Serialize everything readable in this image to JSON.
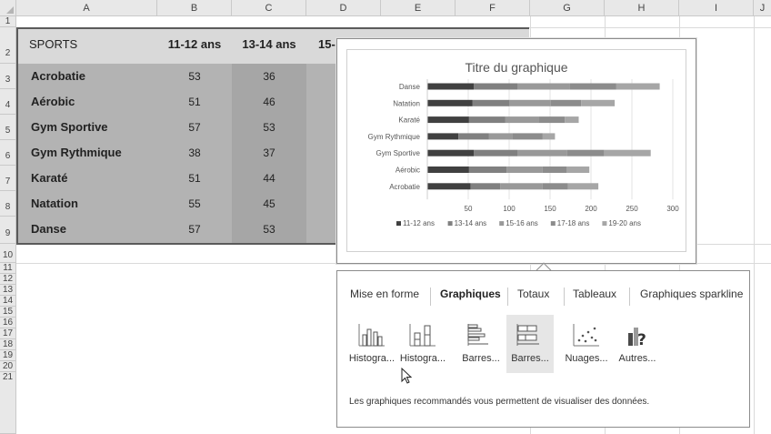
{
  "grid": {
    "columns": [
      "A",
      "B",
      "C",
      "D",
      "E",
      "F",
      "G",
      "H",
      "I",
      "J"
    ],
    "rows": [
      "1",
      "2",
      "3",
      "4",
      "5",
      "6",
      "7",
      "8",
      "9",
      "10",
      "11",
      "12",
      "13",
      "14",
      "15",
      "16",
      "17",
      "18",
      "19",
      "20",
      "21"
    ]
  },
  "table": {
    "header": [
      "SPORTS",
      "11-12 ans",
      "13-14 ans",
      "15-"
    ],
    "rows": [
      {
        "sport": "Acrobatie",
        "b": "53",
        "c": "36"
      },
      {
        "sport": "Aérobic",
        "b": "51",
        "c": "46"
      },
      {
        "sport": "Gym Sportive",
        "b": "57",
        "c": "53"
      },
      {
        "sport": "Gym Rythmique",
        "b": "38",
        "c": "37"
      },
      {
        "sport": "Karaté",
        "b": "51",
        "c": "44"
      },
      {
        "sport": "Natation",
        "b": "55",
        "c": "45"
      },
      {
        "sport": "Danse",
        "b": "57",
        "c": "53"
      }
    ]
  },
  "chart_data": {
    "type": "bar",
    "orientation": "horizontal",
    "stacked": true,
    "title": "Titre du graphique",
    "categories": [
      "Danse",
      "Natation",
      "Karaté",
      "Gym Rythmique",
      "Gym Sportive",
      "Aérobic",
      "Acrobatie"
    ],
    "series": [
      {
        "name": "11-12 ans",
        "values": [
          57,
          55,
          51,
          38,
          57,
          51,
          53
        ],
        "color": "#404040"
      },
      {
        "name": "13-14 ans",
        "values": [
          53,
          45,
          44,
          37,
          53,
          46,
          36
        ],
        "color": "#808080"
      },
      {
        "name": "15-16 ans",
        "values": [
          64,
          51,
          41,
          29,
          61,
          44,
          52
        ],
        "color": "#999999"
      },
      {
        "name": "17-18 ans",
        "values": [
          57,
          37,
          32,
          37,
          45,
          29,
          31
        ],
        "color": "#8c8c8c"
      },
      {
        "name": "19-20 ans",
        "values": [
          53,
          41,
          17,
          15,
          57,
          28,
          37
        ],
        "color": "#a6a6a6"
      }
    ],
    "xticks": [
      "50",
      "100",
      "150",
      "200",
      "250",
      "300"
    ],
    "xlim": [
      0,
      300
    ],
    "grid": true,
    "legend": "bottom"
  },
  "quick_analysis": {
    "tabs": [
      "Mise en forme",
      "Graphiques",
      "Totaux",
      "Tableaux",
      "Graphiques sparkline"
    ],
    "active_tab": "Graphiques",
    "options": [
      {
        "label": "Histogra...",
        "icon": "clustered-column-icon"
      },
      {
        "label": "Histogra...",
        "icon": "stacked-column-icon"
      },
      {
        "label": "Barres...",
        "icon": "clustered-bar-icon"
      },
      {
        "label": "Barres...",
        "icon": "stacked-bar-icon"
      },
      {
        "label": "Nuages...",
        "icon": "scatter-icon"
      },
      {
        "label": "Autres...",
        "icon": "more-charts-icon"
      }
    ],
    "footer": "Les graphiques recommandés vous permettent de visualiser des données."
  }
}
